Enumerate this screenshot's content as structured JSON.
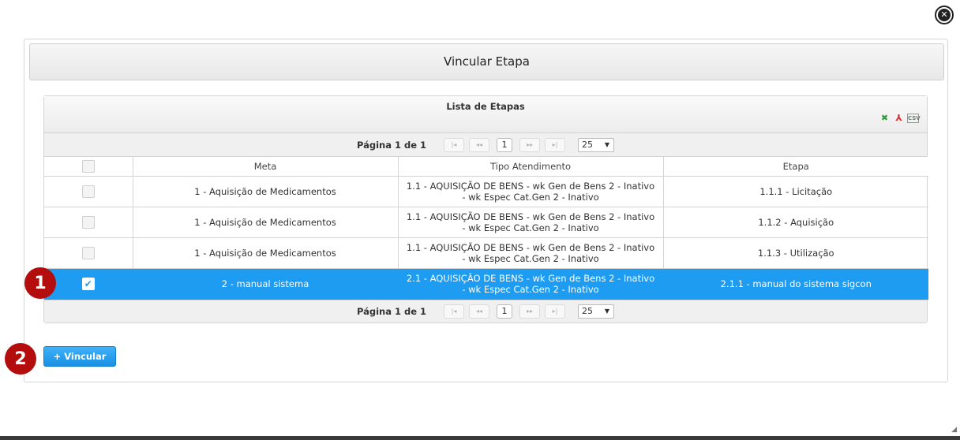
{
  "dialog": {
    "title": "Vincular Etapa",
    "close_icon": "close-icon"
  },
  "grid": {
    "caption": "Lista de Etapas",
    "export_icons": [
      "excel-icon",
      "pdf-icon",
      "csv-icon"
    ],
    "pager": {
      "info": "Página 1 de 1",
      "first": "|◂",
      "prev": "◂◂",
      "page": "1",
      "next": "▸▸",
      "last": "▸|",
      "page_size": "25"
    },
    "columns": [
      "Meta",
      "Tipo Atendimento",
      "Etapa"
    ],
    "rows": [
      {
        "meta": "1 - Aquisição de Medicamentos",
        "tipo": "1.1 - AQUISIÇÃO DE BENS - wk Gen de Bens 2 - Inativo - wk Espec Cat.Gen 2 - Inativo",
        "etapa": "1.1.1 - Licitação",
        "checked": false
      },
      {
        "meta": "1 - Aquisição de Medicamentos",
        "tipo": "1.1 - AQUISIÇÃO DE BENS - wk Gen de Bens 2 - Inativo - wk Espec Cat.Gen 2 - Inativo",
        "etapa": "1.1.2 - Aquisição",
        "checked": false
      },
      {
        "meta": "1 - Aquisição de Medicamentos",
        "tipo": "1.1 - AQUISIÇÃO DE BENS - wk Gen de Bens 2 - Inativo - wk Espec Cat.Gen 2 - Inativo",
        "etapa": "1.1.3 - Utilização",
        "checked": false
      },
      {
        "meta": "2 - manual sistema",
        "tipo": "2.1 - AQUISIÇÃO DE BENS - wk Gen de Bens 2 - Inativo - wk Espec Cat.Gen 2 - Inativo",
        "etapa": "2.1.1 - manual do sistema sigcon",
        "checked": true
      }
    ]
  },
  "actions": {
    "vincular_label": "+ Vincular"
  },
  "markers": [
    "1",
    "2"
  ],
  "colors": {
    "selected_row": "#1e9cf2",
    "marker": "#b30d0d",
    "button": "#1890e4"
  }
}
